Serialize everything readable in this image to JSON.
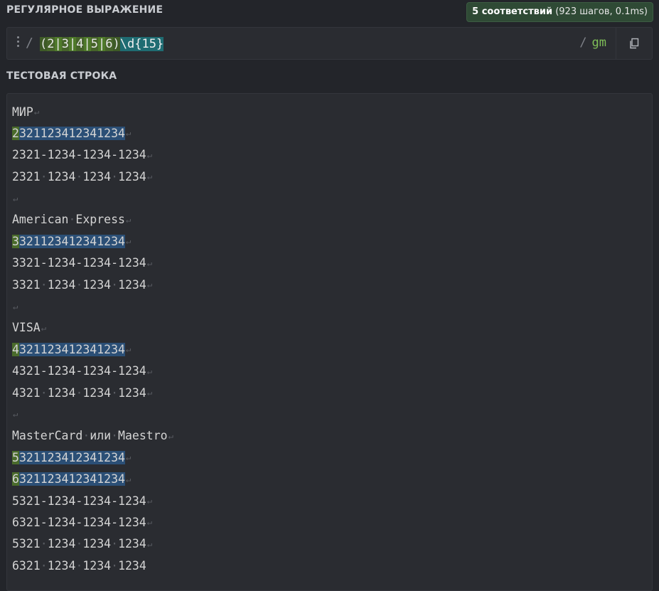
{
  "regex_section": {
    "title": "РЕГУЛЯРНОЕ ВЫРАЖЕНИЕ",
    "match_count_bold": "5 соответствий",
    "match_count_detail": "(923 шагов, 0.1ms)",
    "delimiter_open": "/",
    "tokens": [
      {
        "text": "(",
        "type": "group"
      },
      {
        "text": "2",
        "type": "alt"
      },
      {
        "text": "|",
        "type": "pipe"
      },
      {
        "text": "3",
        "type": "alt"
      },
      {
        "text": "|",
        "type": "pipe"
      },
      {
        "text": "4",
        "type": "alt"
      },
      {
        "text": "|",
        "type": "pipe"
      },
      {
        "text": "5",
        "type": "alt"
      },
      {
        "text": "|",
        "type": "pipe"
      },
      {
        "text": "6",
        "type": "alt"
      },
      {
        "text": ")",
        "type": "group"
      },
      {
        "text": "\\d{15}",
        "type": "class"
      }
    ],
    "delimiter_close": "/",
    "flags": "gm"
  },
  "test_section": {
    "title": "ТЕСТОВАЯ СТРОКА",
    "lines": [
      {
        "text": "МИР",
        "match": false,
        "nl": true
      },
      {
        "text": "2321123412341234",
        "match": true,
        "nl": true
      },
      {
        "text": "2321-1234-1234-1234",
        "match": false,
        "nl": true
      },
      {
        "text": "2321 1234 1234 1234",
        "match": false,
        "nl": true
      },
      {
        "text": "",
        "match": false,
        "nl": true
      },
      {
        "text": "American Express",
        "match": false,
        "nl": true
      },
      {
        "text": "3321123412341234",
        "match": true,
        "nl": true
      },
      {
        "text": "3321-1234-1234-1234",
        "match": false,
        "nl": true
      },
      {
        "text": "3321 1234 1234 1234",
        "match": false,
        "nl": true
      },
      {
        "text": "",
        "match": false,
        "nl": true
      },
      {
        "text": "VISA",
        "match": false,
        "nl": true
      },
      {
        "text": "4321123412341234",
        "match": true,
        "nl": true
      },
      {
        "text": "4321-1234-1234-1234",
        "match": false,
        "nl": true
      },
      {
        "text": "4321 1234 1234 1234",
        "match": false,
        "nl": true
      },
      {
        "text": "",
        "match": false,
        "nl": true
      },
      {
        "text": "MasterCard или Maestro",
        "match": false,
        "nl": true
      },
      {
        "text": "5321123412341234",
        "match": true,
        "nl": true
      },
      {
        "text": "6321123412341234",
        "match": true,
        "nl": true
      },
      {
        "text": "5321-1234-1234-1234",
        "match": false,
        "nl": true
      },
      {
        "text": "6321-1234-1234-1234",
        "match": false,
        "nl": true
      },
      {
        "text": "5321 1234 1234 1234",
        "match": false,
        "nl": true
      },
      {
        "text": "6321 1234 1234 1234",
        "match": false,
        "nl": false
      }
    ]
  },
  "icons": {
    "drag_handle": "drag-handle-icon",
    "copy": "copy-icon",
    "newline": "newline-icon",
    "whitespace": "whitespace-dot-icon"
  },
  "colors": {
    "background": "#23252a",
    "match_group": "#4a6b2b",
    "match_rest": "#2b4f76",
    "flags": "#7fbf58",
    "badge_bg": "#2f4a35"
  }
}
